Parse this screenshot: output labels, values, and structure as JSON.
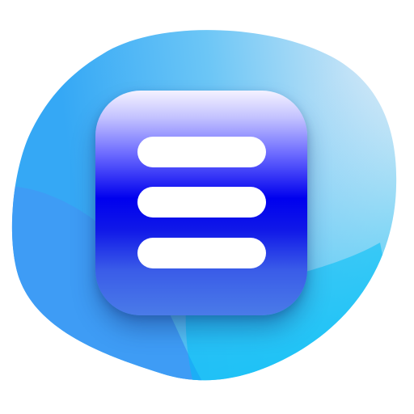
{
  "app_icon": {
    "icon": "menu-icon",
    "colors": {
      "background_blob_light": "#d9ecf8",
      "background_blob_mid": "#5ab8f5",
      "background_blob_dark": "#3f9ff5",
      "background_blob_cyan": "#00bff5",
      "tile_top": "#f4f2ff",
      "tile_middle": "#0000ee",
      "tile_bottom": "#4a7be8",
      "bars": "#ffffff"
    },
    "bars": [
      {
        "name": "top"
      },
      {
        "name": "middle"
      },
      {
        "name": "bottom"
      }
    ]
  }
}
